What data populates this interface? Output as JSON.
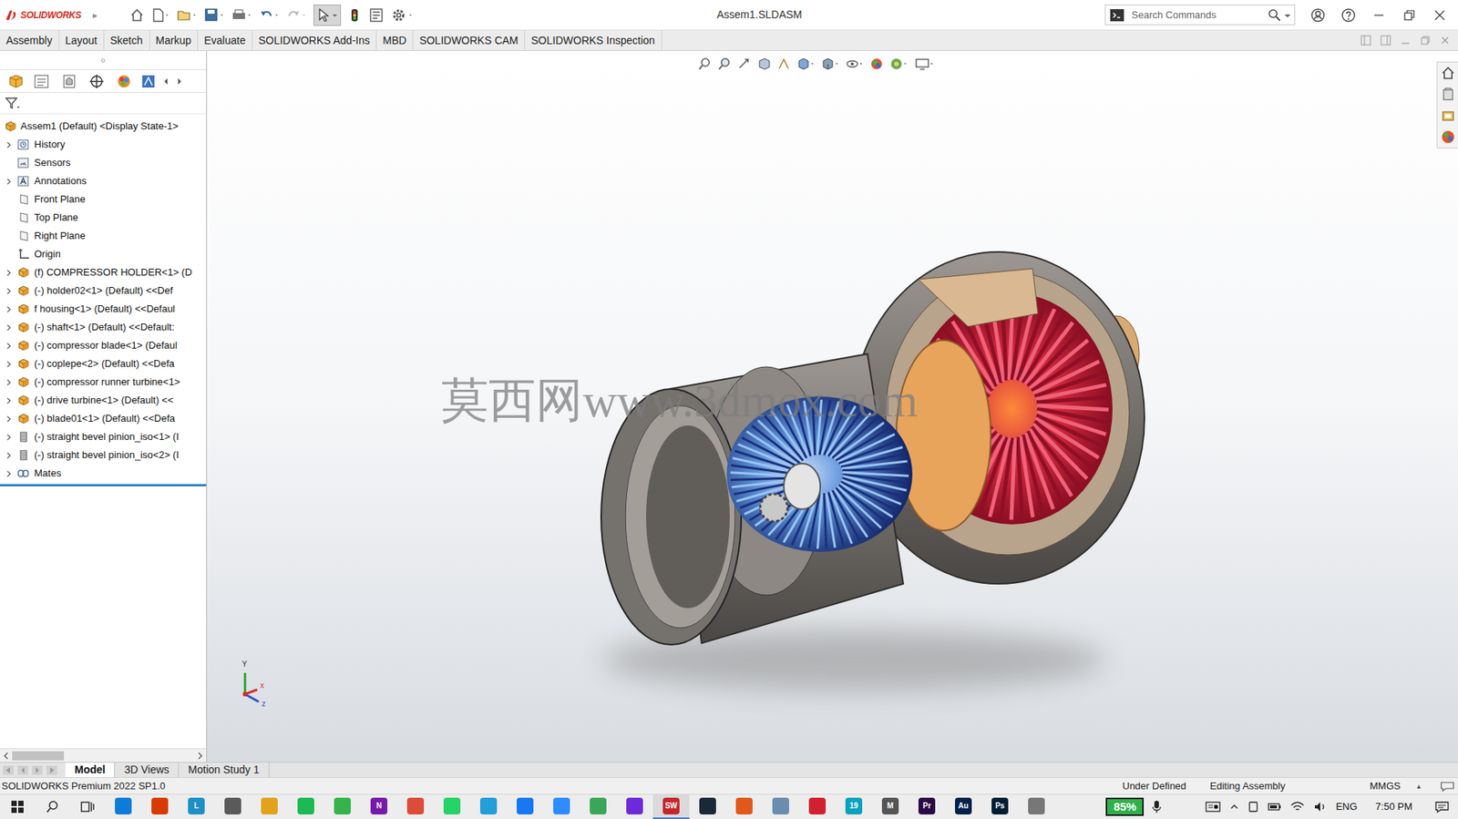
{
  "app": {
    "logo": "SOLIDWORKS",
    "menu_arrow": "▸"
  },
  "window": {
    "title": "Assem1.SLDASM"
  },
  "toolbar": {
    "select_active": true
  },
  "search": {
    "placeholder": "Search Commands"
  },
  "command_tabs": [
    {
      "label": "Assembly",
      "selected": false
    },
    {
      "label": "Layout",
      "selected": false
    },
    {
      "label": "Sketch",
      "selected": false
    },
    {
      "label": "Markup",
      "selected": false
    },
    {
      "label": "Evaluate",
      "selected": false
    },
    {
      "label": "SOLIDWORKS Add-Ins",
      "selected": false
    },
    {
      "label": "MBD",
      "selected": false
    },
    {
      "label": "SOLIDWORKS CAM",
      "selected": false
    },
    {
      "label": "SOLIDWORKS Inspection",
      "selected": false
    }
  ],
  "feature_tree": {
    "root": "Assem1 (Default) <Display State-1>",
    "items": [
      {
        "label": "History",
        "kind": "history",
        "expandable": true
      },
      {
        "label": "Sensors",
        "kind": "sensors",
        "expandable": false
      },
      {
        "label": "Annotations",
        "kind": "annotations",
        "expandable": true
      },
      {
        "label": "Front Plane",
        "kind": "plane",
        "expandable": false
      },
      {
        "label": "Top Plane",
        "kind": "plane",
        "expandable": false
      },
      {
        "label": "Right Plane",
        "kind": "plane",
        "expandable": false
      },
      {
        "label": "Origin",
        "kind": "origin",
        "expandable": false
      },
      {
        "label": "(f) COMPRESSOR HOLDER<1> (D",
        "kind": "component",
        "expandable": true
      },
      {
        "label": "(-) holder02<1> (Default) <<Def",
        "kind": "component",
        "expandable": true
      },
      {
        "label": "f housing<1> (Default) <<Defaul",
        "kind": "component",
        "expandable": true
      },
      {
        "label": "(-) shaft<1> (Default) <<Default:",
        "kind": "component",
        "expandable": true
      },
      {
        "label": "(-) compressor blade<1> (Defaul",
        "kind": "component",
        "expandable": true
      },
      {
        "label": "(-) coplepe<2> (Default) <<Defa",
        "kind": "component",
        "expandable": true
      },
      {
        "label": "(-) compressor runner turbine<1>",
        "kind": "component",
        "expandable": true
      },
      {
        "label": "(-) drive turbine<1> (Default) <<",
        "kind": "component",
        "expandable": true
      },
      {
        "label": "(-) blade01<1> (Default) <<Defa",
        "kind": "component",
        "expandable": true
      },
      {
        "label": "(-) straight bevel pinion_iso<1> (I",
        "kind": "toolbox-part",
        "expandable": true
      },
      {
        "label": "(-) straight bevel pinion_iso<2> (I",
        "kind": "toolbox-part",
        "expandable": true
      },
      {
        "label": "Mates",
        "kind": "mates",
        "expandable": true
      }
    ]
  },
  "viewport": {
    "watermark": "莫西网www.3dmox.com",
    "triad": {
      "y": "Y",
      "x": "x",
      "z": "z"
    }
  },
  "bottom_tabs": [
    {
      "label": "Model",
      "selected": true
    },
    {
      "label": "3D Views",
      "selected": false
    },
    {
      "label": "Motion Study 1",
      "selected": false
    }
  ],
  "status_bar": {
    "product": "SOLIDWORKS Premium 2022 SP1.0",
    "state": "Under Defined",
    "mode": "Editing Assembly",
    "units": "MMGS",
    "units_arrow": "▴"
  },
  "taskbar": {
    "apps": [
      {
        "label": "",
        "color": "#0f7bd8",
        "selected": false
      },
      {
        "label": "",
        "color": "#d83b01",
        "selected": false
      },
      {
        "label": "L",
        "color": "#1e90c8",
        "selected": false
      },
      {
        "label": "",
        "color": "#5a5a5a",
        "selected": false
      },
      {
        "label": "",
        "color": "#e2a21b",
        "selected": false
      },
      {
        "label": "",
        "color": "#1db954",
        "selected": false
      },
      {
        "label": "",
        "color": "#35b34a",
        "selected": false
      },
      {
        "label": "N",
        "color": "#7719aa",
        "selected": false
      },
      {
        "label": "",
        "color": "#dd4b39",
        "selected": false
      },
      {
        "label": "",
        "color": "#25d366",
        "selected": false
      },
      {
        "label": "",
        "color": "#229ed9",
        "selected": false
      },
      {
        "label": "",
        "color": "#1877f2",
        "selected": false
      },
      {
        "label": "",
        "color": "#2d8cff",
        "selected": false
      },
      {
        "label": "",
        "color": "#3aa757",
        "selected": false
      },
      {
        "label": "",
        "color": "#6c2bd9",
        "selected": false
      },
      {
        "label": "SW",
        "color": "#c4262e",
        "selected": true
      },
      {
        "label": "",
        "color": "#1b2838",
        "selected": false
      },
      {
        "label": "",
        "color": "#e2571e",
        "selected": false
      },
      {
        "label": "",
        "color": "#6a8caf",
        "selected": false
      },
      {
        "label": "",
        "color": "#d1202f",
        "selected": false
      },
      {
        "label": "19",
        "color": "#0aa2c0",
        "selected": false
      },
      {
        "label": "M",
        "color": "#555555",
        "selected": false
      },
      {
        "label": "Pr",
        "color": "#2a0a45",
        "selected": false
      },
      {
        "label": "Au",
        "color": "#00214c",
        "selected": false
      },
      {
        "label": "Ps",
        "color": "#001e36",
        "selected": false
      },
      {
        "label": "",
        "color": "#777777",
        "selected": false
      }
    ],
    "battery": "85%",
    "language": "ENG",
    "time": "7:50 PM"
  }
}
